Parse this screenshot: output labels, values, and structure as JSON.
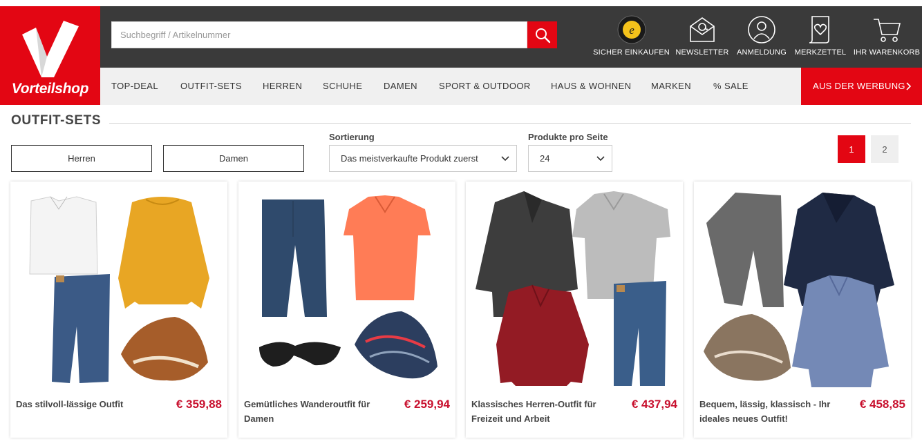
{
  "brand": {
    "name": "Vorteilshop",
    "accent": "#e30613",
    "header_bg": "#3a3a3a"
  },
  "search": {
    "placeholder": "Suchbegriff / Artikelnummer",
    "value": ""
  },
  "header_icons": [
    {
      "label": "SICHER EINKAUFEN",
      "icon": "trusted-shops-seal-icon"
    },
    {
      "label": "NEWSLETTER",
      "icon": "envelope-at-icon"
    },
    {
      "label": "ANMELDUNG",
      "icon": "user-icon"
    },
    {
      "label": "MERKZETTEL",
      "icon": "wishlist-heart-icon"
    },
    {
      "label": "IHR WARENKORB",
      "icon": "cart-icon"
    }
  ],
  "nav": {
    "items": [
      "TOP-DEAL",
      "OUTFIT-SETS",
      "HERREN",
      "SCHUHE",
      "DAMEN",
      "SPORT & OUTDOOR",
      "HAUS & WOHNEN",
      "MARKEN",
      "% SALE"
    ],
    "promo": "AUS DER WERBUNG"
  },
  "page": {
    "title": "OUTFIT-SETS",
    "filters": [
      "Herren",
      "Damen"
    ],
    "sort": {
      "label": "Sortierung",
      "value": "Das meistverkaufte Produkt zuerst"
    },
    "per_page": {
      "label": "Produkte pro Seite",
      "value": "24"
    },
    "pagination": [
      "1",
      "2"
    ]
  },
  "products": [
    {
      "name": "Das stilvoll-lässige Outfit",
      "price": "€ 359,88"
    },
    {
      "name": "Gemütliches Wanderoutfit für Damen",
      "price": "€ 259,94"
    },
    {
      "name": "Klassisches Herren-Outfit für Freizeit und Arbeit",
      "price": "€ 437,94"
    },
    {
      "name": "Bequem, lässig, klassisch - Ihr ideales neues Outfit!",
      "price": "€ 458,85"
    }
  ]
}
